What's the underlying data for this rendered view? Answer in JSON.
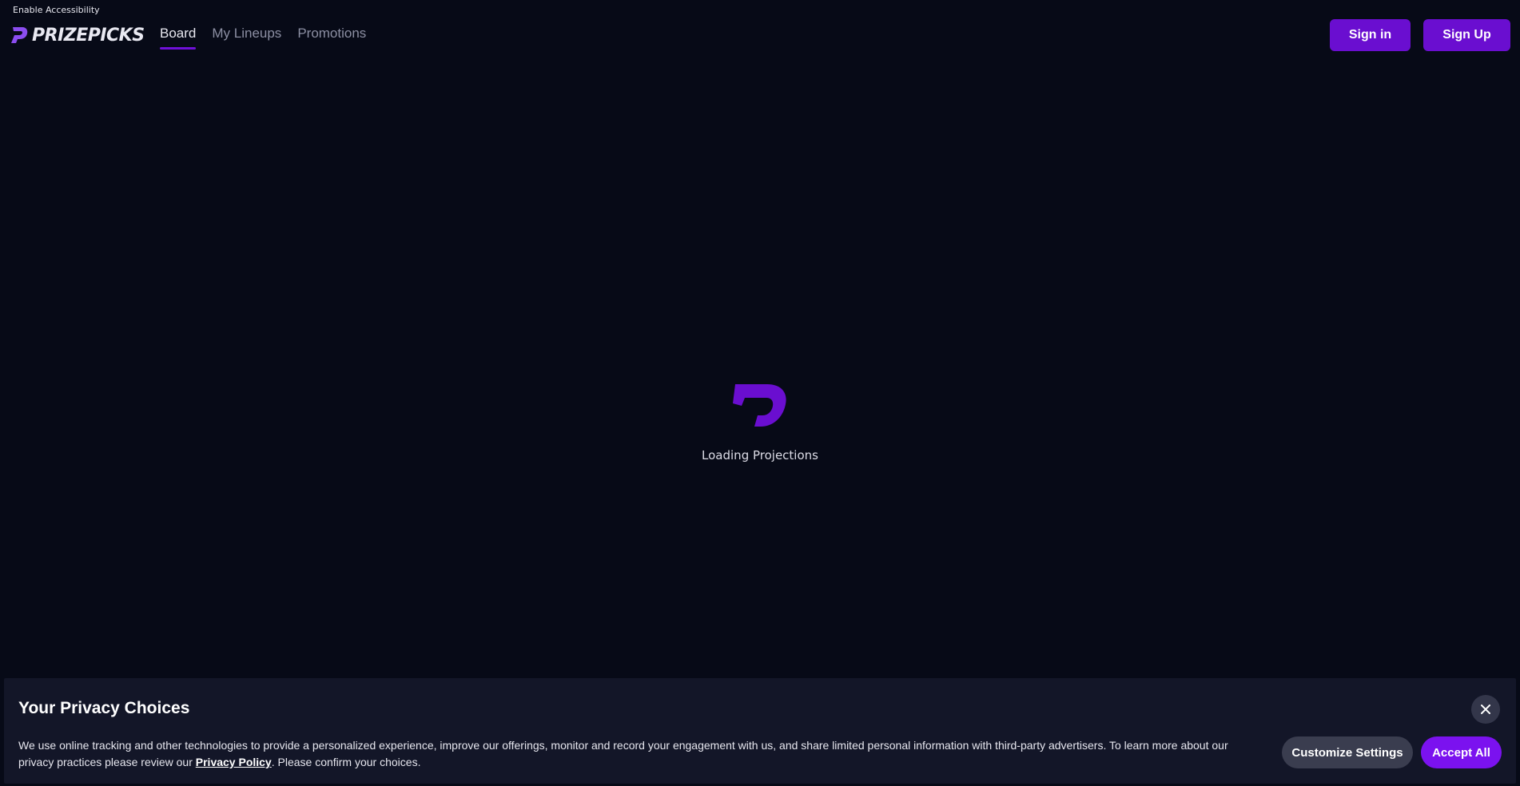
{
  "accessibility": {
    "label": "Enable Accessibility"
  },
  "brand": {
    "name": "PRIZEPICKS",
    "icon": "prizepicks-p-logo-icon",
    "accent_color": "#6a0ed0"
  },
  "nav": {
    "tabs": [
      {
        "label": "Board",
        "active": true
      },
      {
        "label": "My Lineups",
        "active": false
      },
      {
        "label": "Promotions",
        "active": false
      }
    ]
  },
  "auth": {
    "sign_in_label": "Sign in",
    "sign_up_label": "Sign Up"
  },
  "loader": {
    "icon": "prizepicks-p-logo-icon",
    "text": "Loading Projections"
  },
  "privacy": {
    "title": "Your Privacy Choices",
    "body_before_link": "We use online tracking and other technologies to provide a personalized experience, improve our offerings, monitor and record your engagement with us, and share limited personal information with third-party advertisers. To learn more about our privacy practices please review our ",
    "link_label": "Privacy Policy",
    "body_after_link": ". Please confirm your choices.",
    "close_icon": "close-icon",
    "customize_label": "Customize Settings",
    "accept_label": "Accept All",
    "accept_color": "#7b12ef"
  }
}
